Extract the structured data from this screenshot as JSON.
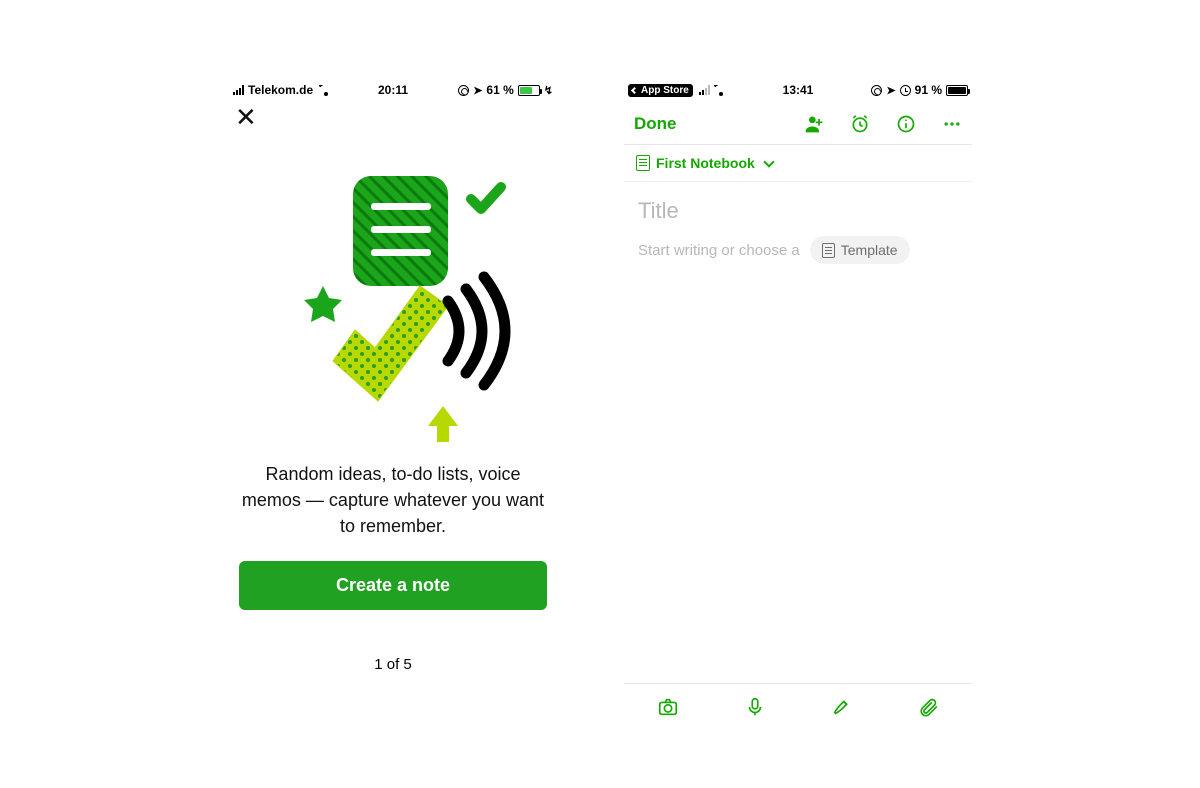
{
  "left": {
    "status": {
      "carrier": "Telekom.de",
      "time": "20:11",
      "battery_pct": "61 %",
      "battery_fill_pct": 61,
      "charging_glyph": "↯",
      "location_glyph": "➤"
    },
    "body_text": "Random ideas, to-do lists, voice memos — capture whatever you want to remember.",
    "cta_label": "Create a note",
    "pager": "1 of 5"
  },
  "right": {
    "status": {
      "back_label": "App Store",
      "time": "13:41",
      "battery_pct": "91 %",
      "battery_fill_pct": 91,
      "location_glyph": "➤"
    },
    "done_label": "Done",
    "notebook_label": "First Notebook",
    "title_placeholder": "Title",
    "body_placeholder": "Start writing or choose a",
    "template_label": "Template"
  },
  "colors": {
    "brand": "#14a800"
  }
}
